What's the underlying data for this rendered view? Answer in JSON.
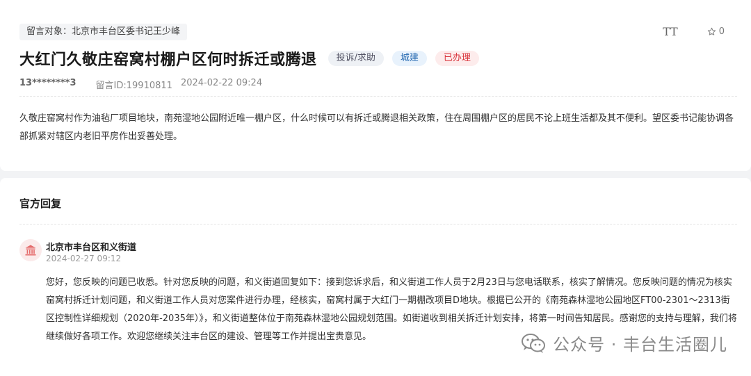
{
  "message": {
    "target": "留言对象：北京市丰台区委书记王少峰",
    "title": "大红门久敬庄窑窝村棚户区何时拆迁或腾退",
    "tags": [
      {
        "label": "投诉/求助",
        "color": "#556677"
      },
      {
        "label": "城建",
        "color": "#2b6db3"
      },
      {
        "label": "已办理",
        "color": "#d9363e"
      }
    ],
    "user": "13********3",
    "message_id": "留言ID:19910811",
    "datetime": "2024-02-22 09:24",
    "content": "久敬庄窑窝村作为油毡厂项目地块，南苑湿地公园附近唯一棚户区，什么时候可以有拆迁或腾退相关政策，住在周围棚户区的居民不论上班生活都及其不便利。望区委书记能协调各部抓紧对辖区内老旧平房作出妥善处理。"
  },
  "toolbar": {
    "font_size_icon": "font-size-icon",
    "font_size_label": "TT",
    "star_icon": "star-icon",
    "favorite_count": "0"
  },
  "reply": {
    "section_title": "官方回复",
    "org_icon": "government-building-icon",
    "org_name": "北京市丰台区和义街道",
    "datetime": "2024-02-27 09:12",
    "text": "您好，您反映的问题已收悉。针对您反映的问题，和义街道回复如下：接到您诉求后，和义街道工作人员于2月23日与您电话联系，核实了解情况。您反映问题的情况为核实窑窝村拆迁计划问题，和义街道工作人员对您案件进行办理，经核实，窑窝村属于大红门一期棚改项目D地块。根据已公开的《南苑森林湿地公园地区FT00-2301～2313街区控制性详细规划（2020年-2035年）》，和义街道整体位于南苑森林湿地公园规划范围。如街道收到相关拆迁计划安排，将第一时间告知居民。感谢您的支持与理解，我们将继续做好各项工作。欢迎您继续关注丰台区的建设、管理等工作并提出宝贵意见。"
  },
  "watermark": {
    "icon": "wechat-icon",
    "text": "公众号 · 丰台生活圈儿"
  },
  "colors": {
    "accent_red": "#d9363e",
    "accent_blue": "#2b6db3",
    "background": "#f2f3f5"
  }
}
